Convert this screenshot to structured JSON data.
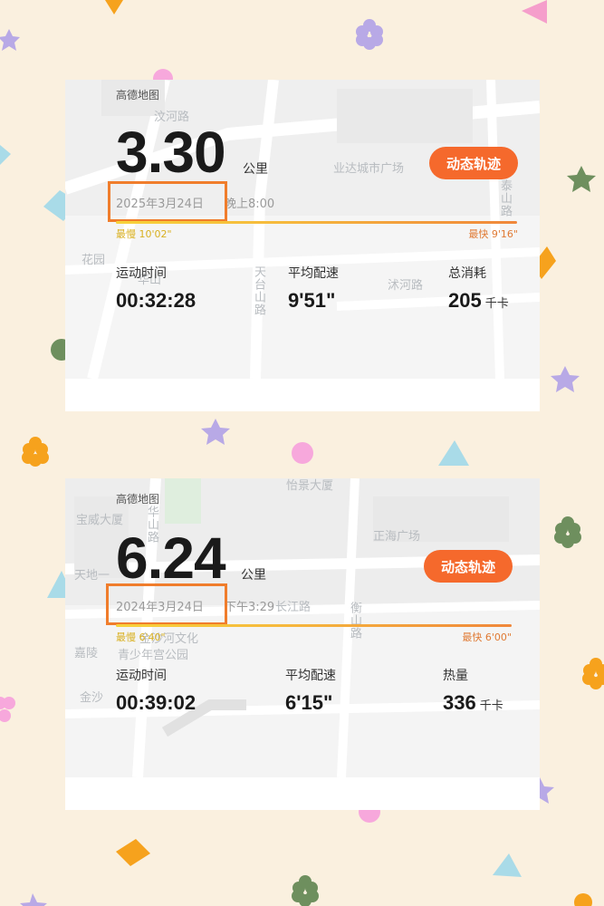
{
  "cards": [
    {
      "source": "高德地图",
      "distance": "3.30",
      "unit": "公里",
      "date": "2025年3月24日",
      "time": "晚上8:00",
      "button": "动态轨迹",
      "slowest_label": "最慢",
      "slowest_value": "10'02\"",
      "fastest_label": "最快",
      "fastest_value": "9'16\"",
      "stats": [
        {
          "label": "运动时间",
          "value": "00:32:28",
          "unit": ""
        },
        {
          "label": "平均配速",
          "value": "9'51\"",
          "unit": ""
        },
        {
          "label": "总消耗",
          "value": "205",
          "unit": "千卡"
        }
      ],
      "map_labels": [
        "汶河路",
        "业达城市广场",
        "泰山路",
        "天台山路",
        "花园",
        "华山",
        "沭河路"
      ]
    },
    {
      "source": "高德地图",
      "distance": "6.24",
      "unit": "公里",
      "date": "2024年3月24日",
      "time": "下午3:29",
      "button": "动态轨迹",
      "slowest_label": "最慢",
      "slowest_value": "6'40\"",
      "fastest_label": "最快",
      "fastest_value": "6'00\"",
      "stats": [
        {
          "label": "运动时间",
          "value": "00:39:02",
          "unit": ""
        },
        {
          "label": "平均配速",
          "value": "6'15\"",
          "unit": ""
        },
        {
          "label": "热量",
          "value": "336",
          "unit": "千卡"
        }
      ],
      "map_labels": [
        "怡景大厦",
        "宝威大厦",
        "正海广场",
        "长江路",
        "衡山路",
        "华山路",
        "天地一",
        "嘉陵",
        "金沙",
        "青少年宫公园",
        "金沙河文化"
      ]
    }
  ],
  "colors": {
    "background": "#faf0df",
    "accent": "#f5692c",
    "highlight_box": "#f07d2c"
  }
}
